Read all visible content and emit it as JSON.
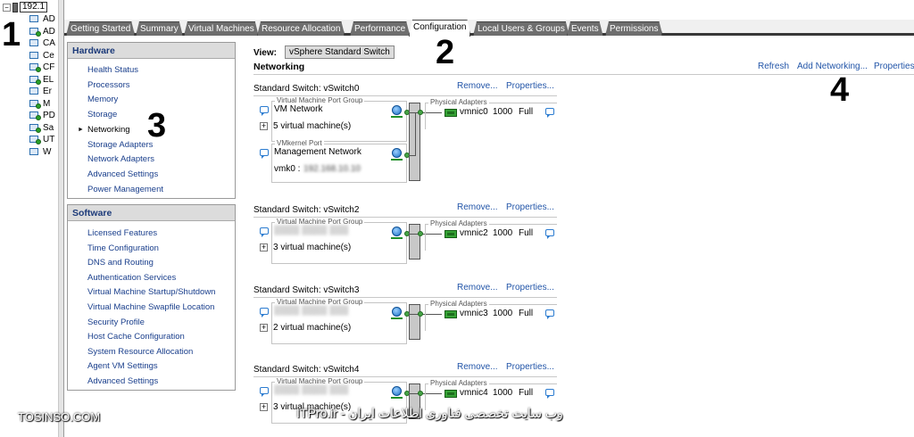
{
  "tree": {
    "host_label": "192.1",
    "vms": [
      {
        "label": "AD",
        "on": false
      },
      {
        "label": "AD",
        "on": true
      },
      {
        "label": "CA",
        "on": false
      },
      {
        "label": "Ce",
        "on": false
      },
      {
        "label": "CF",
        "on": true
      },
      {
        "label": "EL",
        "on": true
      },
      {
        "label": "Er",
        "on": false
      },
      {
        "label": "M",
        "on": true
      },
      {
        "label": "PD",
        "on": true
      },
      {
        "label": "Sa",
        "on": true
      },
      {
        "label": "UT",
        "on": true
      },
      {
        "label": "W",
        "on": false
      }
    ]
  },
  "tabs": [
    {
      "label": "Getting Started"
    },
    {
      "label": "Summary"
    },
    {
      "label": "Virtual Machines"
    },
    {
      "label": "Resource Allocation"
    },
    {
      "label": "Performance"
    },
    {
      "label": "Configuration",
      "active": true
    },
    {
      "label": "Local Users & Groups"
    },
    {
      "label": "Events"
    },
    {
      "label": "Permissions"
    }
  ],
  "hardware": {
    "title": "Hardware",
    "items": [
      "Health Status",
      "Processors",
      "Memory",
      "Storage",
      "Networking",
      "Storage Adapters",
      "Network Adapters",
      "Advanced Settings",
      "Power Management"
    ],
    "selected": "Networking"
  },
  "software": {
    "title": "Software",
    "items": [
      "Licensed Features",
      "Time Configuration",
      "DNS and Routing",
      "Authentication Services",
      "Virtual Machine Startup/Shutdown",
      "Virtual Machine Swapfile Location",
      "Security Profile",
      "Host Cache Configuration",
      "System Resource Allocation",
      "Agent VM Settings",
      "Advanced Settings"
    ]
  },
  "main": {
    "view_label": "View:",
    "view_value": "vSphere Standard Switch",
    "section_title": "Networking",
    "refresh": "Refresh",
    "add_networking": "Add Networking...",
    "properties": "Properties"
  },
  "switches": [
    {
      "title": "Standard Switch: vSwitch0",
      "remove": "Remove...",
      "properties": "Properties...",
      "groups": [
        {
          "caption": "Virtual Machine Port Group",
          "name": "VM Network",
          "name_blurred": false,
          "detail": "5 virtual machine(s)",
          "expand": true
        },
        {
          "caption": "VMkernel Port",
          "name": "Management Network",
          "name_blurred": false,
          "detail_prefix": "vmk0 :",
          "expand": false
        }
      ],
      "adapters_caption": "Physical Adapters",
      "nic": "vmnic0",
      "speed": "1000",
      "duplex": "Full"
    },
    {
      "title": "Standard Switch: vSwitch2",
      "remove": "Remove...",
      "properties": "Properties...",
      "groups": [
        {
          "caption": "Virtual Machine Port Group",
          "name": "",
          "name_blurred": true,
          "detail": "3 virtual machine(s)",
          "expand": true
        }
      ],
      "adapters_caption": "Physical Adapters",
      "nic": "vmnic2",
      "speed": "1000",
      "duplex": "Full"
    },
    {
      "title": "Standard Switch: vSwitch3",
      "remove": "Remove...",
      "properties": "Properties...",
      "groups": [
        {
          "caption": "Virtual Machine Port Group",
          "name": "",
          "name_blurred": true,
          "detail": "2 virtual machine(s)",
          "expand": true
        }
      ],
      "adapters_caption": "Physical Adapters",
      "nic": "vmnic3",
      "speed": "1000",
      "duplex": "Full"
    },
    {
      "title": "Standard Switch: vSwitch4",
      "remove": "Remove...",
      "properties": "Properties...",
      "groups": [
        {
          "caption": "Virtual Machine Port Group",
          "name": "",
          "name_blurred": true,
          "detail": "3 virtual machine(s)",
          "expand": true
        }
      ],
      "adapters_caption": "Physical Adapters",
      "nic": "vmnic4",
      "speed": "1000",
      "duplex": "Full"
    }
  ],
  "annotations": {
    "n1": "1",
    "n2": "2",
    "n3": "3",
    "n4": "4"
  },
  "watermarks": {
    "left": "TOSINSO.COM",
    "right": "ITPro.ir - وب سایت تخصصی فناوری اطلاعات ایران"
  }
}
